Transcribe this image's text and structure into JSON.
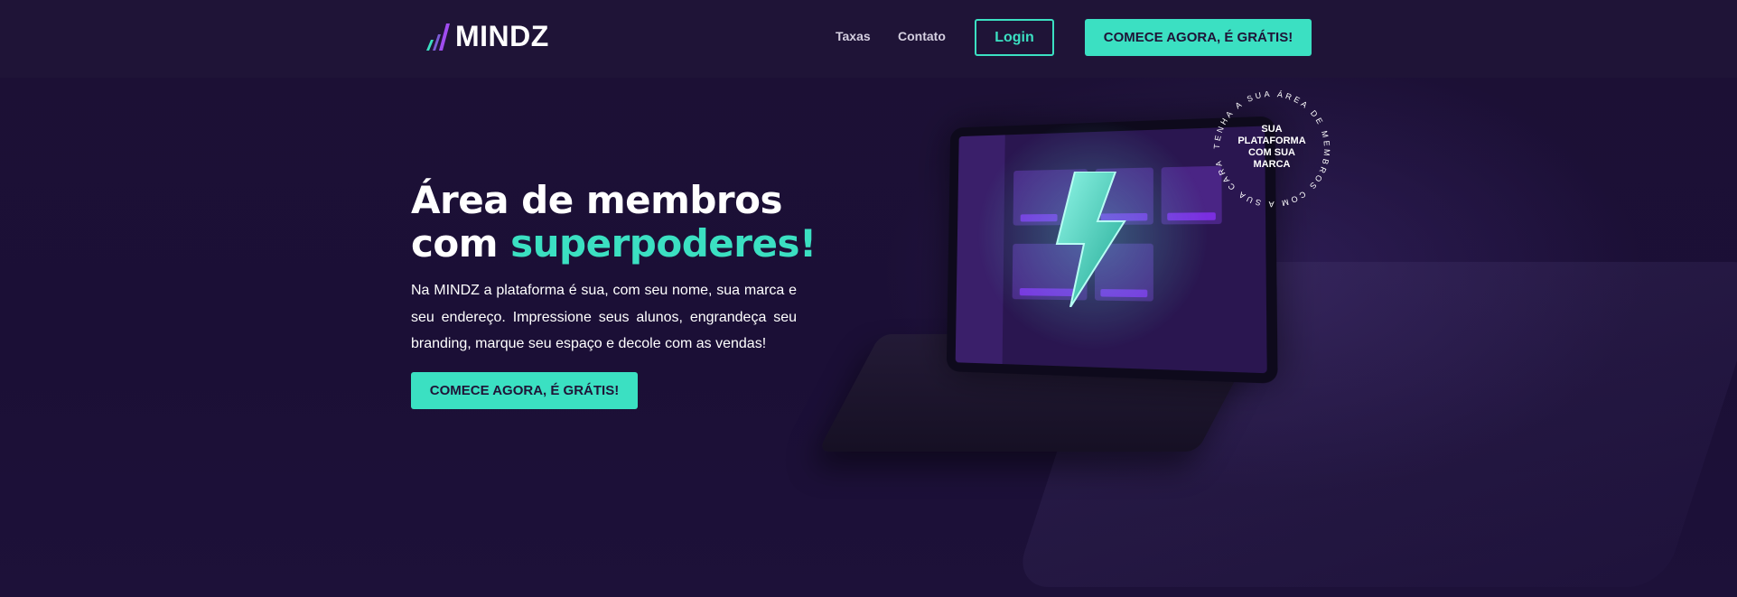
{
  "header": {
    "logo_text": "MINDZ",
    "nav": {
      "taxas": "Taxas",
      "contato": "Contato"
    },
    "login_label": "Login",
    "cta_label": "COMECE AGORA, É GRÁTIS!"
  },
  "hero": {
    "title_line1": "Área de membros",
    "title_line2_prefix": "com ",
    "title_line2_accent": "superpoderes!",
    "description": "Na MINDZ a plataforma é sua, com seu nome, sua marca e seu endereço. Impressione seus alunos, engrandeça seu branding, marque seu espaço e decole com as vendas!",
    "cta_label": "COMECE AGORA, É GRÁTIS!"
  },
  "badge": {
    "center_text": "SUA PLATAFORMA COM SUA MARCA",
    "ring_text": "TENHA A SUA ÁREA DE MEMBROS COM A SUA CARA"
  },
  "colors": {
    "background": "#1a0f33",
    "header": "#1f1437",
    "accent": "#3be0c2",
    "purple": "#7b2ee0"
  },
  "icons": {
    "logo": "mindz-logo-icon",
    "bolt": "lightning-bolt-icon"
  }
}
